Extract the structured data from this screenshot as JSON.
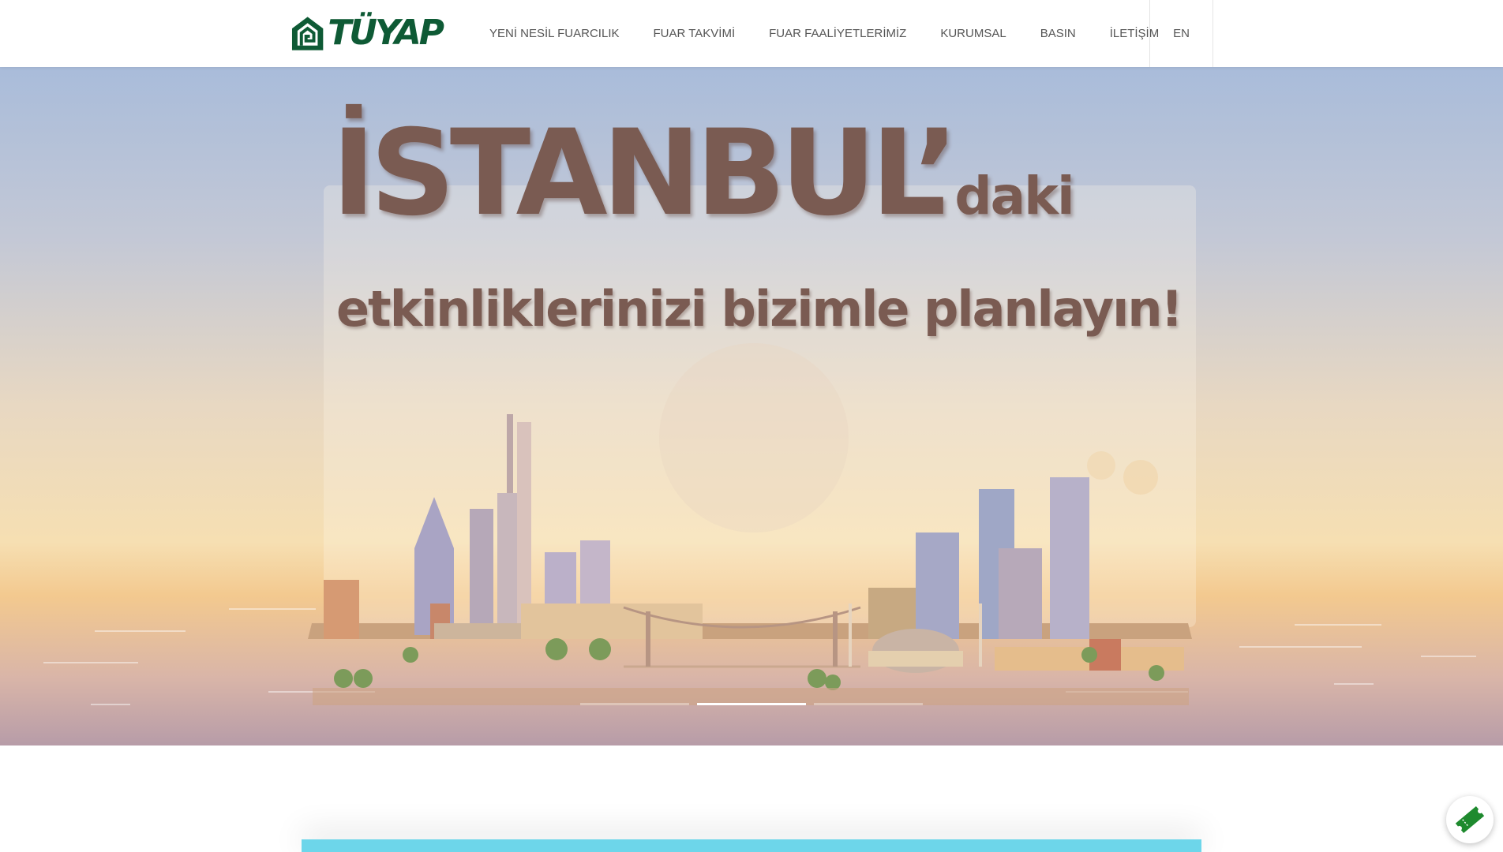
{
  "brand": {
    "logo_text": "TÜYAP",
    "color": "#0e5a35"
  },
  "nav": {
    "items": [
      {
        "label": "YENİ NESİL FUARCILIK"
      },
      {
        "label": "FUAR TAKVİMİ"
      },
      {
        "label": "FUAR FAALİYETLERİMİZ"
      },
      {
        "label": "KURUMSAL"
      },
      {
        "label": "BASIN"
      },
      {
        "label": "İLETİŞİM"
      }
    ],
    "language": "EN"
  },
  "hero": {
    "title_main": "İSTANBUL’",
    "title_suffix": "daki",
    "subtitle": "etkinliklerinizi bizimle planlayın!",
    "text_color": "#7a5b52",
    "slides_total": 3,
    "active_slide": 2
  },
  "floating": {
    "icon": "ticket-icon",
    "color": "#1e8a2e"
  },
  "accent_strip_color": "#6dd6ea"
}
